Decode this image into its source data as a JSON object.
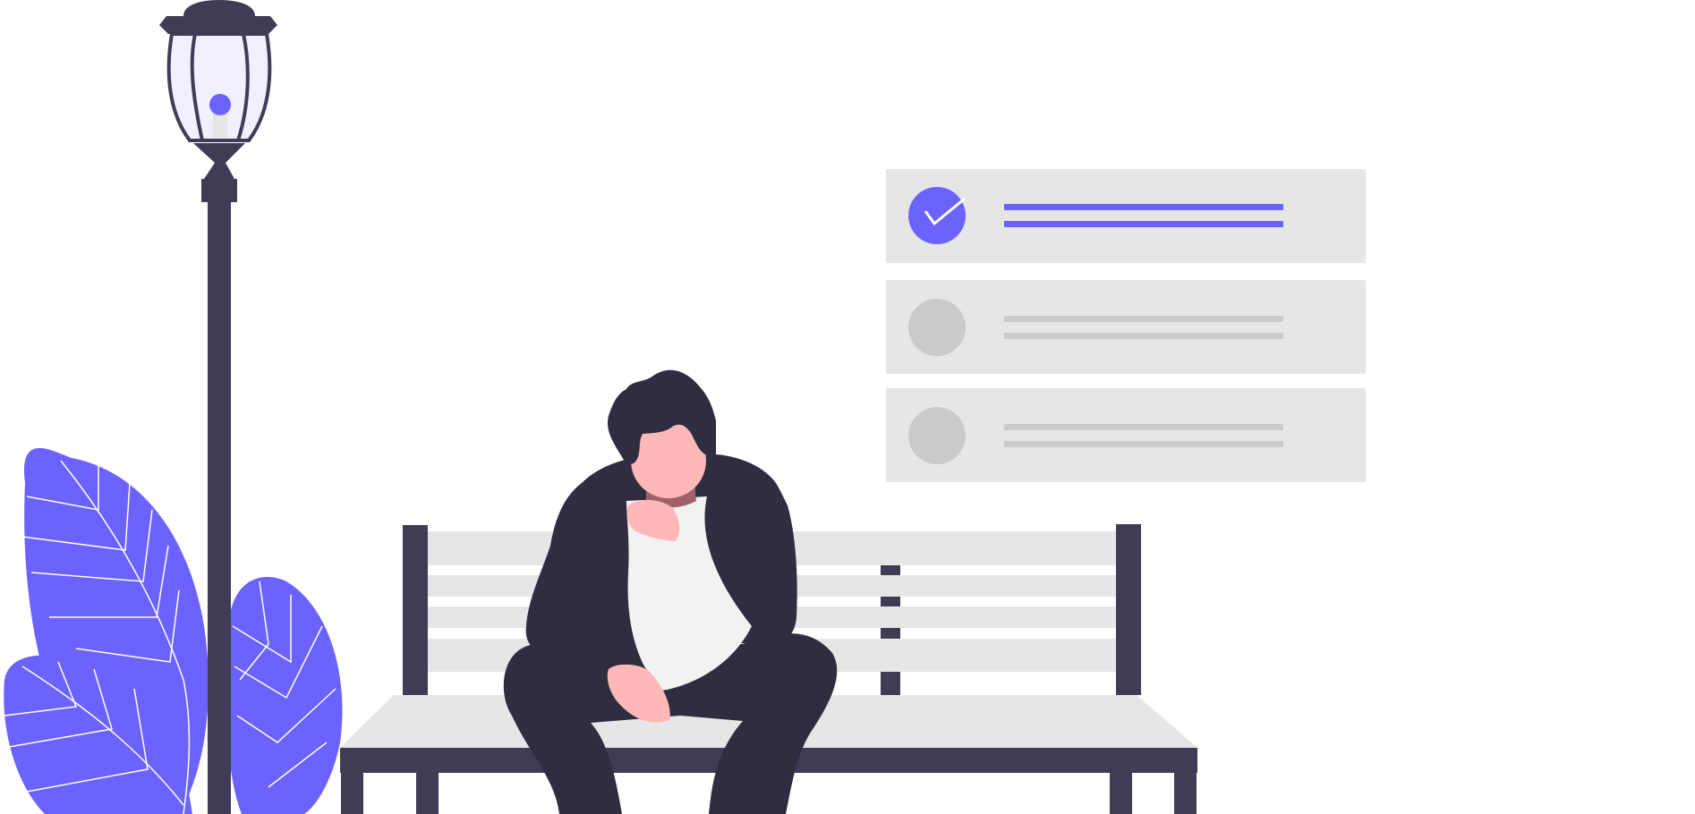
{
  "colors": {
    "accent": "#6c63ff",
    "dark": "#3f3d56",
    "ink": "#2f2e41",
    "panel": "#e6e6e6",
    "placeholder": "#cacaca",
    "skin": "#ffb8b8",
    "lamp_glass": "#f0f0ff",
    "shirt": "#f2f2f2",
    "background": "#ffffff"
  },
  "checklist": {
    "items": [
      {
        "state": "checked",
        "icon": "check-icon"
      },
      {
        "state": "unchecked",
        "icon": "circle-placeholder-icon"
      },
      {
        "state": "unchecked",
        "icon": "circle-placeholder-icon"
      }
    ]
  },
  "scene": {
    "objects": [
      "street-lamp",
      "plant-leaves",
      "park-bench",
      "seated-person",
      "task-checklist"
    ]
  }
}
